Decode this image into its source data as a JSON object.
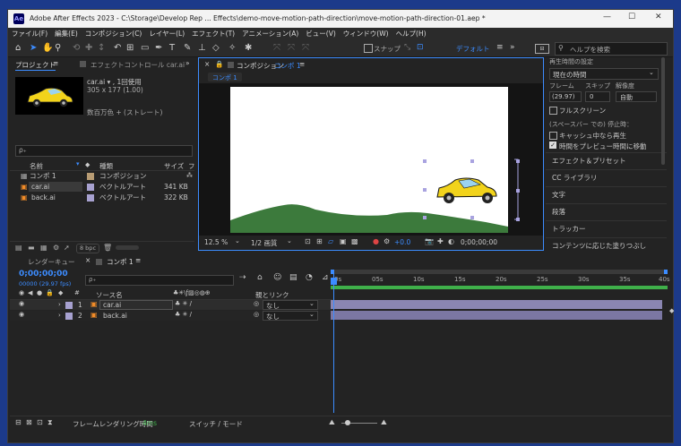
{
  "window": {
    "app_icon": "Ae",
    "title": "Adobe After Effects 2023 - C:\\Storage\\Develop Rep ... Effects\\demo-move-motion-path-direction\\move-motion-path-direction-01.aep *",
    "min": "—",
    "max": "☐",
    "close": "✕"
  },
  "menu": [
    "ファイル(F)",
    "編集(E)",
    "コンポジション(C)",
    "レイヤー(L)",
    "エフェクト(T)",
    "アニメーション(A)",
    "ビュー(V)",
    "ウィンドウ(W)",
    "ヘルプ(H)"
  ],
  "toolbar": {
    "snap_label": "スナップ",
    "workspace": "デフォルト",
    "search_placeholder": "ヘルプを検索"
  },
  "project": {
    "tab": "プロジェクト",
    "effects_tab": "エフェクトコントロール car.ai",
    "item_name": "car.ai ▾ , 1回使用",
    "item_size": "305 x 177 (1.00)",
    "item_color": "数百万色 + (ストレート)",
    "search_placeholder": "ρ₊",
    "headers": {
      "name": "名前",
      "type": "種類",
      "size": "サイズ",
      "frame": "フ"
    },
    "items": [
      {
        "name": "コンポ 1",
        "type": "コンポジション",
        "size": ""
      },
      {
        "name": "car.ai",
        "type": "ベクトルアート",
        "size": "341 KB"
      },
      {
        "name": "back.ai",
        "type": "ベクトルアート",
        "size": "322 KB"
      }
    ],
    "bpc": "8 bpc"
  },
  "comp": {
    "tab": "コンポジション",
    "comp_name": "コンポ 1",
    "subtab": "コンポ 1",
    "zoom": "12.5 %",
    "res": "1/2 画質",
    "exposure": "+0.0",
    "timecode": "0;00;00;00"
  },
  "right": {
    "partial_header": "再生時間の設定",
    "time_label": "現在の時間",
    "frames_label": "フレーム",
    "skip_label": "スキップ",
    "res_label": "解像度",
    "frames_value": "(29.97)",
    "skip_value": "0",
    "res_value": "自動",
    "fullscreen": "フルスクリーン",
    "stop_label": "(スペースバー での) 停止時：",
    "cache_label": "キャッシュ中なら再生",
    "move_label": "時間をプレビュー時間に移動",
    "items": [
      "エフェクト＆プリセット",
      "CC ライブラリ",
      "文字",
      "段落",
      "トラッカー",
      "コンテンツに応じた塗りつぶし"
    ]
  },
  "timeline": {
    "render_tab": "レンダーキュー",
    "comp_tab": "コンポ 1",
    "timecode": "0;00;00;00",
    "sub_timecode": "00000 (29.97 fps)",
    "search_placeholder": "ρ₊",
    "col_source": "ソース名",
    "col_parent": "親とリンク",
    "ruler": [
      "0s",
      "05s",
      "10s",
      "15s",
      "20s",
      "25s",
      "30s",
      "35s",
      "40s"
    ],
    "layers": [
      {
        "num": "1",
        "name": "car.ai",
        "parent": "なし"
      },
      {
        "num": "2",
        "name": "back.ai",
        "parent": "なし"
      }
    ],
    "render_time_label": "フレームレンダリング時間",
    "render_time_value": "4ms",
    "switch_mode": "スイッチ / モード"
  },
  "colors": {
    "accent": "#3c8cff",
    "car": "#f2d31b",
    "hill": "#3c7a3c",
    "layer_bar": "#8a86b2",
    "work_bar": "#3fb04a"
  }
}
